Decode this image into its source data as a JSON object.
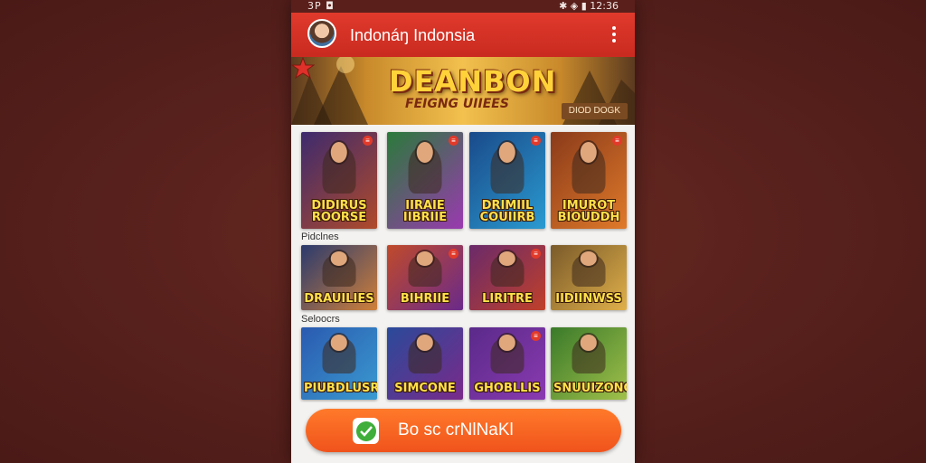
{
  "status_bar": {
    "left": "3P ◘",
    "right": "✱ ◈ ▮ 12:36"
  },
  "app_bar": {
    "title": "Indonáŋ Indonsia",
    "menu_icon": "more-vert-icon"
  },
  "banner": {
    "title": "DEANBON",
    "subtitle": "FEIGNG UIIEES",
    "button": "DIOD DOGK"
  },
  "sections": [
    {
      "label": ""
    },
    {
      "label": "Pidclnes"
    },
    {
      "label": "Seloocrs"
    }
  ],
  "games": [
    [
      {
        "label": "DIDIRUS ROORSE",
        "bg": [
          "#3d2a6e",
          "#b04a2a"
        ],
        "badge": "≡"
      },
      {
        "label": "IIRAIE IIBRIIE",
        "bg": [
          "#2a7a3a",
          "#9a3ab0"
        ],
        "badge": "≡"
      },
      {
        "label": "DRIMIIL COUIIRB",
        "bg": [
          "#1a4a8a",
          "#2a9ad0"
        ],
        "badge": "≡"
      },
      {
        "label": "IMUROT BIOUDDH",
        "bg": [
          "#8a3a1a",
          "#e07a2a"
        ],
        "badge": "≡"
      }
    ],
    [
      {
        "label": "DRAUILIES",
        "bg": [
          "#2a3a6e",
          "#d0803a"
        ],
        "badge": ""
      },
      {
        "label": "BIHRIIE",
        "bg": [
          "#c04a2a",
          "#6a2a8a"
        ],
        "badge": "≡"
      },
      {
        "label": "LIRITRE",
        "bg": [
          "#6a2a6a",
          "#c0402a"
        ],
        "badge": "≡"
      },
      {
        "label": "IIDIINWSS",
        "bg": [
          "#7a5a2a",
          "#e0b04a"
        ],
        "badge": ""
      }
    ],
    [
      {
        "label": "PIUBDLUSRS",
        "bg": [
          "#2a5ab0",
          "#3a9ad0"
        ],
        "badge": ""
      },
      {
        "label": "SIMCONE",
        "bg": [
          "#2a4a9a",
          "#7a2a8a"
        ],
        "badge": ""
      },
      {
        "label": "GHOBLLIS",
        "bg": [
          "#5a2a8a",
          "#8a3ab0"
        ],
        "badge": "≡"
      },
      {
        "label": "SNUUIZONGS",
        "bg": [
          "#3a7a2a",
          "#a0c04a"
        ],
        "badge": ""
      }
    ]
  ],
  "cta": {
    "label": "Bo sc crNlNaKl",
    "icon": "check-icon"
  },
  "colors": {
    "appbar": "#d8342a",
    "cta": "#f4621f",
    "background": "#57201c"
  }
}
